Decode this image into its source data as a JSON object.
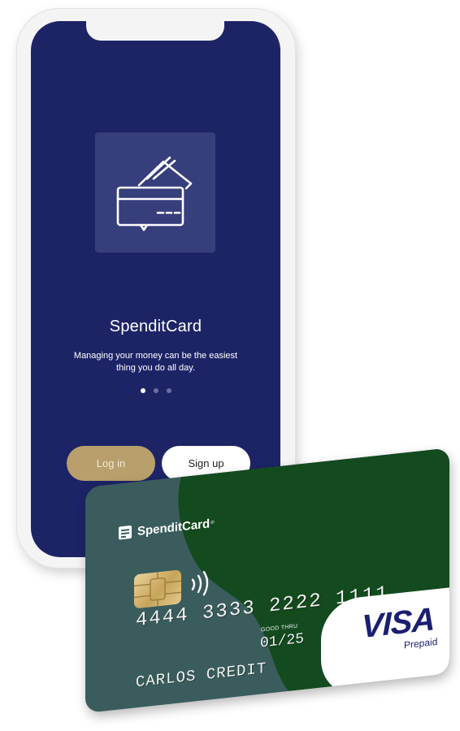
{
  "app": {
    "name": "SpenditCard",
    "tagline": "Managing your money can be the easiest thing you do all day.",
    "carousel": {
      "page_count": 3,
      "active_index": 0
    },
    "buttons": {
      "login": "Log in",
      "signup": "Sign up"
    },
    "colors": {
      "screen_bg": "#1d2466",
      "tile_bg": "#363e7c",
      "login_bg": "#b89f6c",
      "signup_bg": "#ffffff"
    },
    "logo_icon": "credit-cards-icon"
  },
  "card": {
    "brand": "SpenditCard",
    "brand_mark": "®",
    "number": "4444 3333 2222 1111",
    "good_thru_label": "GOOD THRU",
    "expiry": "01/25",
    "holder": "CARLOS CREDIT",
    "network": "VISA",
    "network_sub": "Prepaid",
    "colors": {
      "teal": "#3a5c5c",
      "green": "#134a1e",
      "visa_blue": "#1a1f71"
    }
  }
}
